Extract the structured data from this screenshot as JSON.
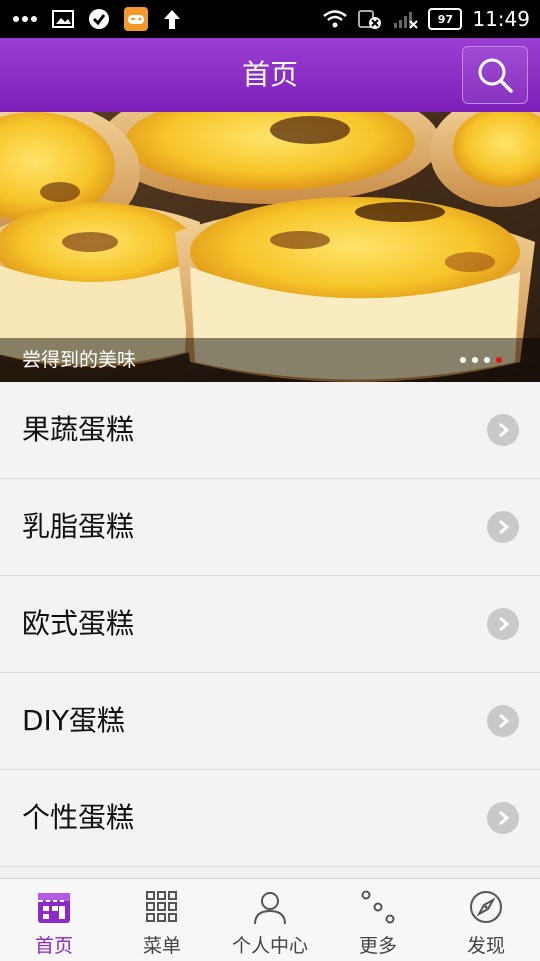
{
  "status_bar": {
    "time": "11:49",
    "battery": "97",
    "icons": [
      "more-dots-icon",
      "image-icon",
      "check-icon",
      "game-icon",
      "upload-arrow-icon",
      "wifi-icon",
      "sim-icon",
      "signal-icon",
      "battery-icon"
    ]
  },
  "header": {
    "title": "首页",
    "search_icon": "search-icon"
  },
  "banner": {
    "caption": "尝得到的美味",
    "dots_total": 4,
    "active_dot": 3
  },
  "list": {
    "items": [
      {
        "label": "果蔬蛋糕"
      },
      {
        "label": "乳脂蛋糕"
      },
      {
        "label": "欧式蛋糕"
      },
      {
        "label": "DIY蛋糕"
      },
      {
        "label": "个性蛋糕"
      }
    ]
  },
  "tabs": {
    "items": [
      {
        "label": "首页",
        "icon": "store-icon",
        "active": true
      },
      {
        "label": "菜单",
        "icon": "grid-icon",
        "active": false
      },
      {
        "label": "个人中心",
        "icon": "person-icon",
        "active": false
      },
      {
        "label": "更多",
        "icon": "more-circles-icon",
        "active": false
      },
      {
        "label": "发现",
        "icon": "compass-icon",
        "active": false
      }
    ]
  },
  "colors": {
    "accent": "#8b2ac9",
    "header_top": "#9b3fd3",
    "header_bottom": "#7c1fb8",
    "active_dot": "#ee1111"
  }
}
